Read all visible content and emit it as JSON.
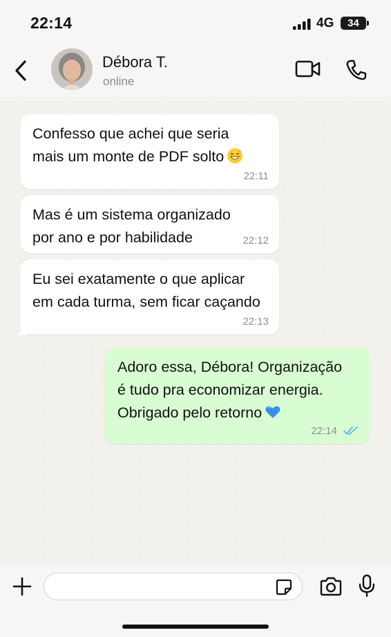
{
  "status_bar": {
    "time": "22:14",
    "network": "4G",
    "battery": "34"
  },
  "header": {
    "contact_name": "Débora T.",
    "contact_status": "online",
    "icons": [
      "back-icon",
      "video-call-icon",
      "phone-icon"
    ]
  },
  "messages": [
    {
      "direction": "incoming",
      "text": "Confesso que achei que seria\nmais um monte de PDF solto",
      "emoji": "grinning-sweat-emoji",
      "time": "22:11"
    },
    {
      "direction": "incoming",
      "text": "Mas é um sistema organizado\npor ano e por habilidade",
      "time": "22:12"
    },
    {
      "direction": "incoming",
      "text": "Eu sei exatamente o que aplicar\nem cada turma, sem ficar caçando",
      "time": "22:13"
    },
    {
      "direction": "outgoing",
      "text": "Adoro essa, Débora! Organização\né tudo pra economizar energia.\nObrigado pelo retorno",
      "emoji": "blue-heart-emoji",
      "time": "22:14",
      "status": "read"
    }
  ],
  "input_bar": {
    "placeholder": "",
    "icons": [
      "plus-icon",
      "sticker-icon",
      "camera-icon",
      "microphone-icon"
    ]
  },
  "colors": {
    "outgoing_bubble": "#d9fdd3",
    "incoming_bubble": "#ffffff",
    "read_ticks": "#53bdeb",
    "chat_background": "#f3f1ec"
  }
}
